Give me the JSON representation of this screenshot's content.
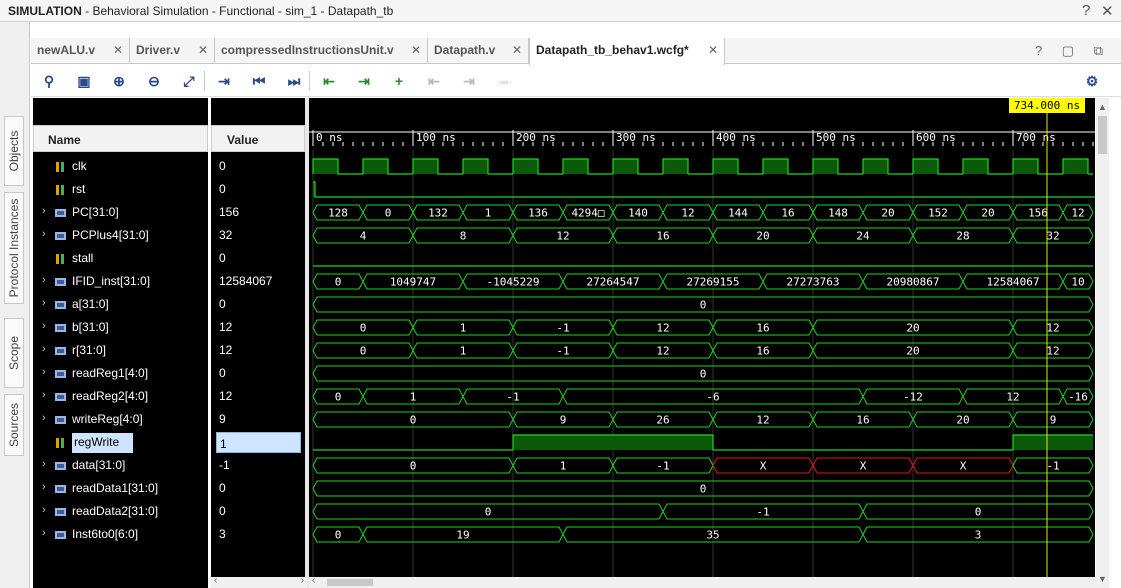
{
  "window": {
    "title_bold": "SIMULATION",
    "title_rest": " - Behavioral Simulation - Functional - sim_1 - Datapath_tb",
    "help": "?",
    "close": "✕"
  },
  "side_tabs": [
    "Objects",
    "Protocol Instances",
    "Scope",
    "Sources"
  ],
  "tabs": [
    {
      "label": "newALU.v",
      "close": "✕"
    },
    {
      "label": "Driver.v",
      "close": "✕"
    },
    {
      "label": "compressedInstructionsUnit.v",
      "close": "✕"
    },
    {
      "label": "Datapath.v",
      "close": "✕"
    },
    {
      "label": "Datapath_tb_behav1.wcfg*",
      "close": "✕"
    }
  ],
  "tab_controls": "? ▢ ⧉",
  "columns": {
    "name": "Name",
    "value": "Value"
  },
  "cursor_label": "734.000 ns",
  "time_labels": [
    "0 ns",
    "100 ns",
    "200 ns",
    "300 ns",
    "400 ns",
    "500 ns",
    "600 ns",
    "700 ns"
  ],
  "signals": [
    {
      "name": "clk",
      "value": "0",
      "bus": false,
      "expandable": false
    },
    {
      "name": "rst",
      "value": "0",
      "bus": false,
      "expandable": false
    },
    {
      "name": "PC[31:0]",
      "value": "156",
      "bus": true,
      "expandable": true
    },
    {
      "name": "PCPlus4[31:0]",
      "value": "32",
      "bus": true,
      "expandable": true
    },
    {
      "name": "stall",
      "value": "0",
      "bus": false,
      "expandable": false
    },
    {
      "name": "IFID_inst[31:0]",
      "value": "12584067",
      "bus": true,
      "expandable": true
    },
    {
      "name": "a[31:0]",
      "value": "0",
      "bus": true,
      "expandable": true
    },
    {
      "name": "b[31:0]",
      "value": "12",
      "bus": true,
      "expandable": true
    },
    {
      "name": "r[31:0]",
      "value": "12",
      "bus": true,
      "expandable": true
    },
    {
      "name": "readReg1[4:0]",
      "value": "0",
      "bus": true,
      "expandable": true
    },
    {
      "name": "readReg2[4:0]",
      "value": "12",
      "bus": true,
      "expandable": true
    },
    {
      "name": "writeReg[4:0]",
      "value": "9",
      "bus": true,
      "expandable": true
    },
    {
      "name": "regWrite",
      "value": "1",
      "bus": false,
      "expandable": false,
      "selected": true
    },
    {
      "name": "data[31:0]",
      "value": "-1",
      "bus": true,
      "expandable": true
    },
    {
      "name": "readData1[31:0]",
      "value": "0",
      "bus": true,
      "expandable": true
    },
    {
      "name": "readData2[31:0]",
      "value": "0",
      "bus": true,
      "expandable": true
    },
    {
      "name": "Inst6to0[6:0]",
      "value": "3",
      "bus": true,
      "expandable": true
    }
  ],
  "waves": [
    {
      "type": "clock",
      "period": 50
    },
    {
      "type": "bit",
      "segs": [
        [
          0,
          2,
          1
        ],
        [
          2,
          800,
          0
        ]
      ]
    },
    {
      "type": "bus",
      "segs": [
        [
          0,
          50,
          "128"
        ],
        [
          50,
          100,
          "0"
        ],
        [
          100,
          150,
          "132"
        ],
        [
          150,
          200,
          "1"
        ],
        [
          200,
          250,
          "136"
        ],
        [
          250,
          300,
          "4294□"
        ],
        [
          300,
          350,
          "140"
        ],
        [
          350,
          400,
          "12"
        ],
        [
          400,
          450,
          "144"
        ],
        [
          450,
          500,
          "16"
        ],
        [
          500,
          550,
          "148"
        ],
        [
          550,
          600,
          "20"
        ],
        [
          600,
          650,
          "152"
        ],
        [
          650,
          700,
          "20"
        ],
        [
          700,
          750,
          "156"
        ],
        [
          750,
          780,
          "12"
        ]
      ]
    },
    {
      "type": "bus",
      "segs": [
        [
          0,
          100,
          "4"
        ],
        [
          100,
          200,
          "8"
        ],
        [
          200,
          300,
          "12"
        ],
        [
          300,
          400,
          "16"
        ],
        [
          400,
          500,
          "20"
        ],
        [
          500,
          600,
          "24"
        ],
        [
          600,
          700,
          "28"
        ],
        [
          700,
          780,
          "32"
        ]
      ]
    },
    {
      "type": "bit",
      "segs": [
        [
          0,
          780,
          0
        ]
      ]
    },
    {
      "type": "bus",
      "segs": [
        [
          0,
          50,
          "0"
        ],
        [
          50,
          150,
          "1049747"
        ],
        [
          150,
          250,
          "-1045229"
        ],
        [
          250,
          350,
          "27264547"
        ],
        [
          350,
          450,
          "27269155"
        ],
        [
          450,
          550,
          "27273763"
        ],
        [
          550,
          650,
          "20980867"
        ],
        [
          650,
          750,
          "12584067"
        ],
        [
          750,
          780,
          "10"
        ]
      ]
    },
    {
      "type": "bus",
      "segs": [
        [
          0,
          780,
          "0"
        ]
      ]
    },
    {
      "type": "bus",
      "segs": [
        [
          0,
          100,
          "0"
        ],
        [
          100,
          200,
          "1"
        ],
        [
          200,
          300,
          "-1"
        ],
        [
          300,
          400,
          "12"
        ],
        [
          400,
          500,
          "16"
        ],
        [
          500,
          700,
          "20"
        ],
        [
          700,
          780,
          "12"
        ]
      ]
    },
    {
      "type": "bus",
      "segs": [
        [
          0,
          100,
          "0"
        ],
        [
          100,
          200,
          "1"
        ],
        [
          200,
          300,
          "-1"
        ],
        [
          300,
          400,
          "12"
        ],
        [
          400,
          500,
          "16"
        ],
        [
          500,
          700,
          "20"
        ],
        [
          700,
          780,
          "12"
        ]
      ]
    },
    {
      "type": "bus",
      "segs": [
        [
          0,
          780,
          "0"
        ]
      ]
    },
    {
      "type": "bus",
      "segs": [
        [
          0,
          50,
          "0"
        ],
        [
          50,
          150,
          "1"
        ],
        [
          150,
          250,
          "-1"
        ],
        [
          250,
          550,
          "-6"
        ],
        [
          550,
          650,
          "-12"
        ],
        [
          650,
          750,
          "12"
        ],
        [
          750,
          780,
          "-16"
        ]
      ]
    },
    {
      "type": "bus",
      "segs": [
        [
          0,
          200,
          "0"
        ],
        [
          200,
          300,
          "9"
        ],
        [
          300,
          400,
          "26"
        ],
        [
          400,
          500,
          "12"
        ],
        [
          500,
          600,
          "16"
        ],
        [
          600,
          700,
          "20"
        ],
        [
          700,
          780,
          "9"
        ]
      ]
    },
    {
      "type": "bit",
      "segs": [
        [
          0,
          200,
          0
        ],
        [
          200,
          400,
          1
        ],
        [
          400,
          700,
          0
        ],
        [
          700,
          780,
          1
        ]
      ]
    },
    {
      "type": "bus",
      "segs": [
        [
          0,
          200,
          "0"
        ],
        [
          200,
          300,
          "1"
        ],
        [
          300,
          400,
          "-1"
        ],
        [
          400,
          500,
          "X",
          "red"
        ],
        [
          500,
          600,
          "X",
          "red"
        ],
        [
          600,
          700,
          "X",
          "red"
        ],
        [
          700,
          780,
          "-1"
        ]
      ]
    },
    {
      "type": "bus",
      "segs": [
        [
          0,
          780,
          "0"
        ]
      ]
    },
    {
      "type": "bus",
      "segs": [
        [
          0,
          350,
          "0"
        ],
        [
          350,
          550,
          "-1"
        ],
        [
          550,
          780,
          "0"
        ]
      ]
    },
    {
      "type": "bus",
      "segs": [
        [
          0,
          50,
          "0"
        ],
        [
          50,
          250,
          "19"
        ],
        [
          250,
          550,
          "35"
        ],
        [
          550,
          780,
          "3"
        ]
      ]
    }
  ],
  "cursor_time_ns": 734
}
